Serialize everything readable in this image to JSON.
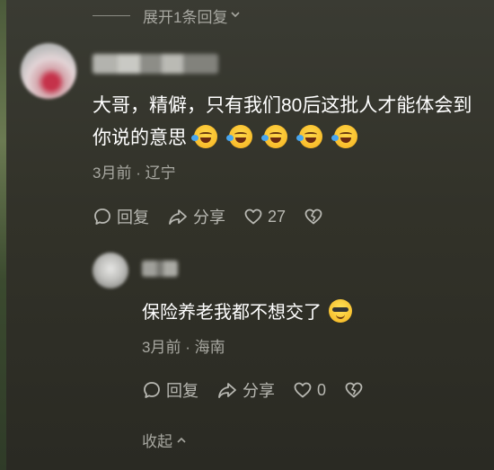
{
  "thread": {
    "expand_replies": "展开1条回复",
    "collapse": "收起"
  },
  "comment_1": {
    "text": "大哥，精僻，只有我们80后这批人才能体会到你说的意思",
    "emoji_count": 5,
    "emoji": "rolling-on-floor-laughing-emoji",
    "date": "3月前",
    "separator": " · ",
    "location": "辽宁",
    "reply_label": "回复",
    "share_label": "分享",
    "like_count": "27"
  },
  "comment_2": {
    "text": "保险养老我都不想交了",
    "emoji": "sunglasses-smile-emoji",
    "date": "3月前",
    "separator": " · ",
    "location": "海南",
    "reply_label": "回复",
    "share_label": "分享",
    "like_count": "0"
  },
  "colors": {
    "background": "#33332b",
    "muted_text": "#a8a8a1",
    "action_text": "#b8b8b2"
  }
}
